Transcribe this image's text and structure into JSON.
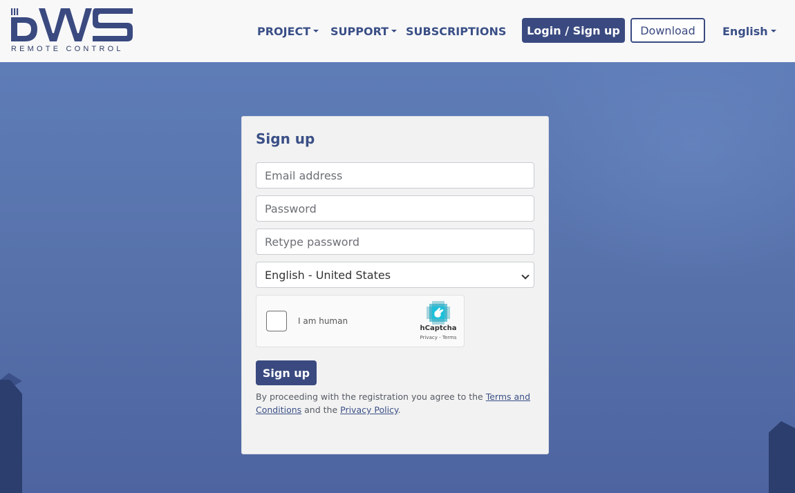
{
  "header": {
    "logo": {
      "wordmark": "DWS",
      "subtitle": "REMOTE CONTROL"
    },
    "nav": {
      "project": "PROJECT",
      "support": "SUPPORT",
      "subscriptions": "SUBSCRIPTIONS"
    },
    "login_button": "Login / Sign up",
    "download_button": "Download",
    "language": "English"
  },
  "form": {
    "title": "Sign up",
    "email_placeholder": "Email address",
    "password_placeholder": "Password",
    "retype_placeholder": "Retype password",
    "language_selected": "English - United States",
    "captcha": {
      "label": "I am human",
      "brand": "hCaptcha",
      "privacy": "Privacy",
      "separator": " - ",
      "terms": "Terms"
    },
    "submit_button": "Sign up",
    "terms": {
      "prefix": "By proceeding with the registration you agree to the ",
      "terms_link": "Terms and Conditions",
      "middle": " and the ",
      "privacy_link": "Privacy Policy",
      "suffix": "."
    }
  },
  "colors": {
    "brand": "#3a4a80",
    "nav_text": "#3a4f86",
    "header_bg": "#f8f8f9",
    "hero_bg": "#5b78b0",
    "card_bg": "#f2f2f2"
  }
}
